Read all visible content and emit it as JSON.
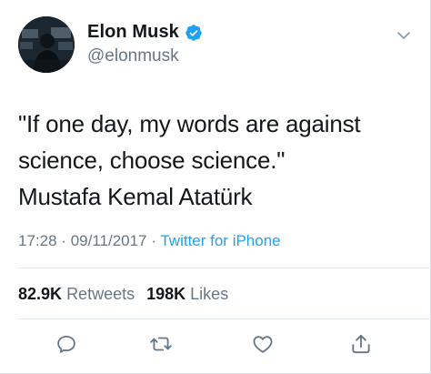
{
  "user": {
    "display_name": "Elon Musk",
    "handle": "@elonmusk",
    "verified": true
  },
  "tweet": {
    "text_lines": [
      "\"If one day, my words are against",
      "science, choose science.\"",
      "Mustafa Kemal Atatürk"
    ],
    "time": "17:28",
    "date": "09/11/2017",
    "separator": "·",
    "source": "Twitter for iPhone"
  },
  "stats": {
    "retweets_count": "82.9K",
    "retweets_label": "Retweets",
    "likes_count": "198K",
    "likes_label": "Likes"
  },
  "icons": {
    "verified": "verified-badge-icon",
    "menu": "chevron-down-icon",
    "reply": "reply-icon",
    "retweet": "retweet-icon",
    "like": "heart-icon",
    "share": "share-icon"
  },
  "colors": {
    "text": "#14171a",
    "secondary": "#657786",
    "link": "#1da1f2",
    "verified": "#1da1f2",
    "divider": "#e1e8ed"
  }
}
